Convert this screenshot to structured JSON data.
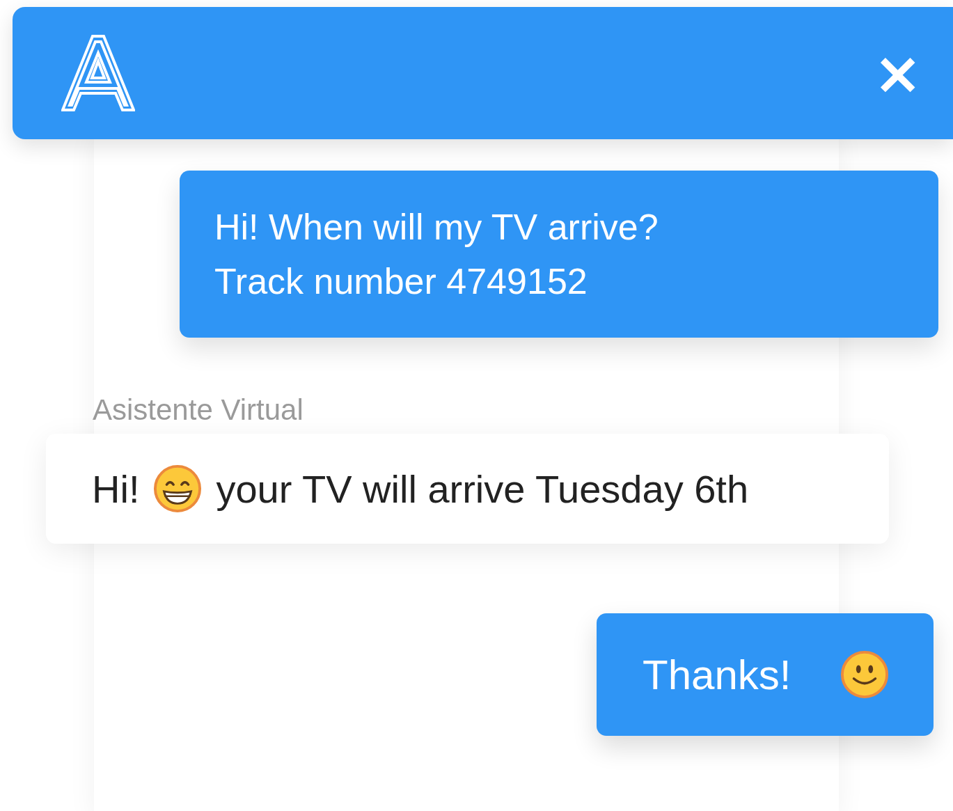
{
  "header": {
    "close_label": "×"
  },
  "messages": [
    {
      "kind": "user",
      "lines": [
        "Hi! When will my TV arrive?",
        "Track number 4749152"
      ]
    },
    {
      "kind": "bot",
      "sender": "Asistente Virtual",
      "parts": [
        "Hi!",
        "your TV will arrive Tuesday 6th"
      ]
    },
    {
      "kind": "user_short",
      "lines": [
        "Thanks!"
      ]
    }
  ]
}
